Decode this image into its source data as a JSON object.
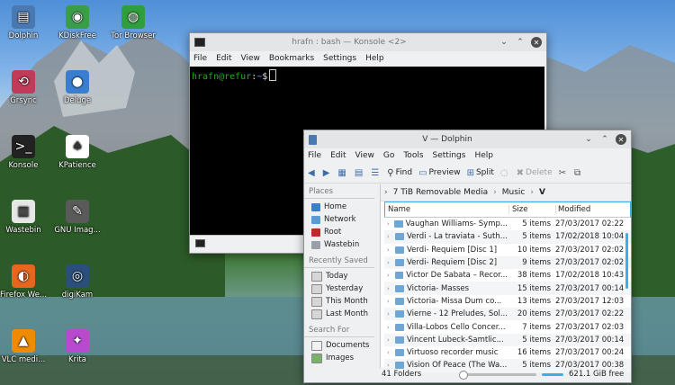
{
  "desktop_icons": [
    {
      "label": "Dolphin",
      "icon": "folder-icon",
      "color": "#4a78b0"
    },
    {
      "label": "KDiskFree",
      "icon": "disk-icon",
      "color": "#3a9d4a"
    },
    {
      "label": "Tor Browser",
      "icon": "globe-icon",
      "color": "#2f9e3c"
    },
    {
      "label": "Grsync",
      "icon": "sync-icon",
      "color": "#c23a5a"
    },
    {
      "label": "Deluge",
      "icon": "drop-icon",
      "color": "#3a7ed0"
    },
    {
      "label": "Konsole",
      "icon": "terminal-icon",
      "color": "#222222"
    },
    {
      "label": "KPatience",
      "icon": "cards-icon",
      "color": "#ffffff"
    },
    {
      "label": "Wastebin",
      "icon": "trash-icon",
      "color": "#e6e6e6"
    },
    {
      "label": "GNU Imag...",
      "icon": "gimp-icon",
      "color": "#5a5a5a"
    },
    {
      "label": "Firefox We...",
      "icon": "firefox-icon",
      "color": "#e8651e"
    },
    {
      "label": "digiKam",
      "icon": "camera-icon",
      "color": "#2a4f7a"
    },
    {
      "label": "VLC medi...",
      "icon": "vlc-icon",
      "color": "#f08a00"
    },
    {
      "label": "Krita",
      "icon": "brush-icon",
      "color": "#b84ad0"
    }
  ],
  "konsole": {
    "title": "hrafn : bash — Konsole <2>",
    "menu": [
      "File",
      "Edit",
      "View",
      "Bookmarks",
      "Settings",
      "Help"
    ],
    "prompt_user": "hrafn@refur",
    "prompt_dir": "~",
    "prompt_symbol": "$"
  },
  "dolphin": {
    "title": "V — Dolphin",
    "menu": [
      "File",
      "Edit",
      "View",
      "Go",
      "Tools",
      "Settings",
      "Help"
    ],
    "toolbar": {
      "find": "Find",
      "preview": "Preview",
      "split": "Split",
      "delete": "Delete"
    },
    "places": {
      "places_header": "Places",
      "places_items": [
        "Home",
        "Network",
        "Root",
        "Wastebin"
      ],
      "recent_header": "Recently Saved",
      "recent_items": [
        "Today",
        "Yesterday",
        "This Month",
        "Last Month"
      ],
      "search_header": "Search For",
      "search_items": [
        "Documents",
        "Images"
      ]
    },
    "breadcrumb": [
      "7 TiB Removable Media",
      "Music",
      "V"
    ],
    "columns": {
      "name": "Name",
      "size": "Size",
      "modified": "Modified"
    },
    "rows": [
      {
        "name": "Vaughan Williams- Symp...",
        "size": "5 items",
        "modified": "27/03/2017 02:22"
      },
      {
        "name": "Verdi - La traviata - Suth...",
        "size": "5 items",
        "modified": "17/02/2018 10:04"
      },
      {
        "name": "Verdi- Requiem [Disc 1]",
        "size": "10 items",
        "modified": "27/03/2017 02:02"
      },
      {
        "name": "Verdi- Requiem [Disc 2]",
        "size": "9 items",
        "modified": "27/03/2017 02:02"
      },
      {
        "name": "Victor De Sabata – Recor...",
        "size": "38 items",
        "modified": "17/02/2018 10:43"
      },
      {
        "name": "Victoria- Masses",
        "size": "15 items",
        "modified": "27/03/2017 00:14"
      },
      {
        "name": "Victoria- Missa Dum co...",
        "size": "13 items",
        "modified": "27/03/2017 12:03"
      },
      {
        "name": "Vierne - 12 Preludes, Sol...",
        "size": "20 items",
        "modified": "27/03/2017 02:22"
      },
      {
        "name": "Villa-Lobos Cello Concer...",
        "size": "7 items",
        "modified": "27/03/2017 02:03"
      },
      {
        "name": "Vincent Lubeck-Samtlic...",
        "size": "5 items",
        "modified": "27/03/2017 00:14"
      },
      {
        "name": "Virtuoso recorder music",
        "size": "16 items",
        "modified": "27/03/2017 00:24"
      },
      {
        "name": "Vision Of Peace (The Wa...",
        "size": "5 items",
        "modified": "27/03/2017 00:38"
      }
    ],
    "status": {
      "folders": "41 Folders",
      "free": "621.1 GiB free"
    }
  }
}
